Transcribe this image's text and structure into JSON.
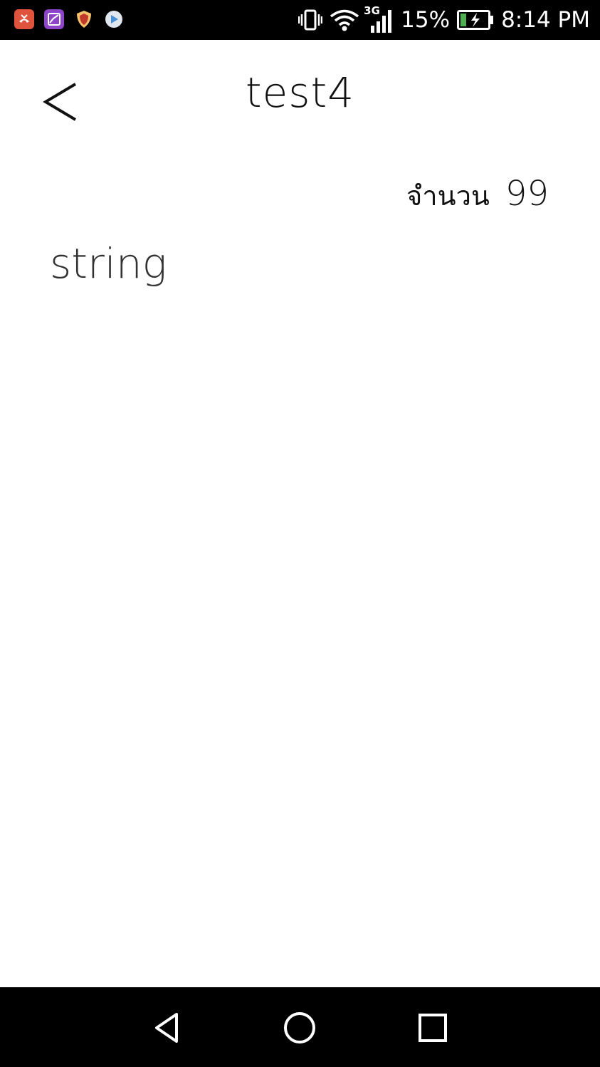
{
  "status_bar": {
    "notifications": [
      {
        "icon": "missed-call-icon",
        "color": "#e0533d"
      },
      {
        "icon": "gallery-icon",
        "color": "#8e44c9"
      },
      {
        "icon": "security-shield-icon",
        "color": "#d35400"
      },
      {
        "icon": "play-store-icon",
        "color": "#4a90d9"
      }
    ],
    "battery_percent": "15%",
    "time": "8:14 PM",
    "network": "3G"
  },
  "header": {
    "title": "test4",
    "back_icon": "chevron-left-icon"
  },
  "count": {
    "label": "จำนวน",
    "value": "99"
  },
  "content": {
    "text": "string"
  },
  "nav_bar": {
    "back": "nav-back-icon",
    "home": "nav-home-icon",
    "recents": "nav-recents-icon"
  },
  "colors": {
    "background": "#ffffff",
    "bars": "#000000",
    "text": "#111111",
    "battery_fill": "#4caf50"
  }
}
